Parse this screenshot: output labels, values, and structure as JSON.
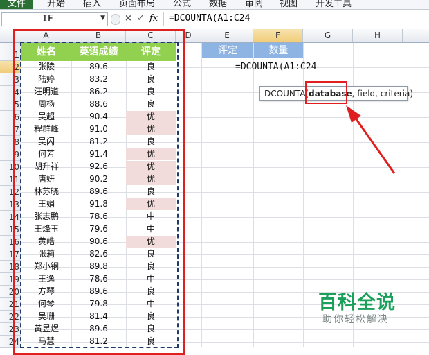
{
  "ribbon": {
    "tabs": [
      "文件",
      "开始",
      "插入",
      "页面布局",
      "公式",
      "数据",
      "审阅",
      "视图",
      "开发工具"
    ]
  },
  "formula_bar": {
    "name_box": "IF",
    "cancel_icon": "×",
    "enter_icon": "✓",
    "fx_label": "fx",
    "formula": "=DCOUNTA(A1:C24"
  },
  "columns": [
    "A",
    "B",
    "C",
    "D",
    "E",
    "F",
    "G",
    "H"
  ],
  "rows": [
    "1",
    "2",
    "3",
    "4",
    "5",
    "6",
    "7",
    "8",
    "9",
    "10",
    "11",
    "12",
    "13",
    "14",
    "15",
    "16",
    "17",
    "18",
    "19",
    "20",
    "21",
    "22",
    "23",
    "24"
  ],
  "table": {
    "headers": [
      "姓名",
      "英语成绩",
      "评定"
    ],
    "records": [
      [
        "张陵",
        "89.6",
        "良"
      ],
      [
        "陆婷",
        "83.2",
        "良"
      ],
      [
        "汪明道",
        "86.2",
        "良"
      ],
      [
        "周杨",
        "88.6",
        "良"
      ],
      [
        "吴超",
        "90.4",
        "优"
      ],
      [
        "程群峰",
        "91.0",
        "优"
      ],
      [
        "吴闪",
        "81.2",
        "良"
      ],
      [
        "何芳",
        "91.4",
        "优"
      ],
      [
        "胡升祥",
        "92.6",
        "优"
      ],
      [
        "唐妍",
        "90.2",
        "优"
      ],
      [
        "林苏晓",
        "89.6",
        "良"
      ],
      [
        "王娟",
        "91.8",
        "优"
      ],
      [
        "张志鹏",
        "78.6",
        "中"
      ],
      [
        "王烽玉",
        "79.6",
        "中"
      ],
      [
        "黄皓",
        "90.6",
        "优"
      ],
      [
        "张莉",
        "82.6",
        "良"
      ],
      [
        "郑小钢",
        "89.8",
        "良"
      ],
      [
        "王逸",
        "78.6",
        "中"
      ],
      [
        "方琴",
        "89.6",
        "良"
      ],
      [
        "何琴",
        "79.8",
        "中"
      ],
      [
        "吴珊",
        "81.4",
        "良"
      ],
      [
        "黄昱煜",
        "89.6",
        "良"
      ],
      [
        "马慧",
        "81.2",
        "良"
      ]
    ]
  },
  "criteria": {
    "headers": [
      "评定",
      "数量"
    ]
  },
  "editing_cell": {
    "formula": "=DCOUNTA(A1:C24"
  },
  "tooltip": {
    "func": "DCOUNTA(",
    "arg_bold": "database",
    "rest": ", field, criteria)"
  },
  "watermark": {
    "title": "百科全说",
    "subtitle": "助你轻松解决"
  },
  "colors": {
    "header_green": "#92d050",
    "header_blue": "#8db4e2",
    "excellent_pink": "#f2dcdb",
    "annotation_red": "#e02020",
    "watermark_green": "#1aa05a"
  }
}
